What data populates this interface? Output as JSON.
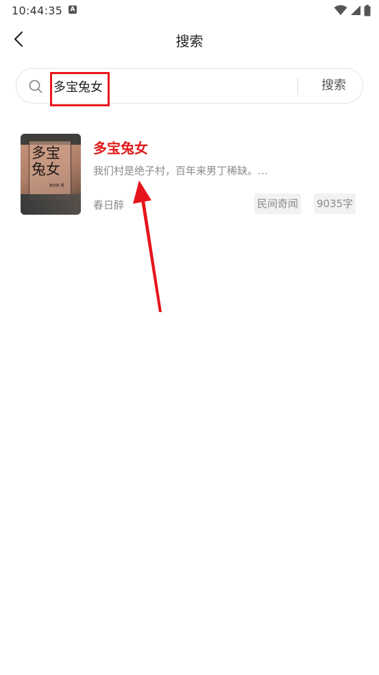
{
  "status_bar": {
    "time": "10:44:35",
    "notification_glyph": "A"
  },
  "header": {
    "title": "搜索",
    "back_icon": "back-arrow-icon"
  },
  "search": {
    "query": "多宝兔女",
    "submit_label": "搜索",
    "icon": "search-icon"
  },
  "results": [
    {
      "title": "多宝兔女",
      "description": "我们村是绝子村，百年来男丁稀缺。…",
      "author": "春日醉",
      "tags": [
        "民间奇闻",
        "9035字"
      ],
      "cover": {
        "title": "多宝兔女",
        "author": "春日醉 著"
      }
    }
  ],
  "colors": {
    "accent_red": "#e21b1b",
    "highlight_red": "#e8141b",
    "muted_text": "#8a8a8a"
  }
}
